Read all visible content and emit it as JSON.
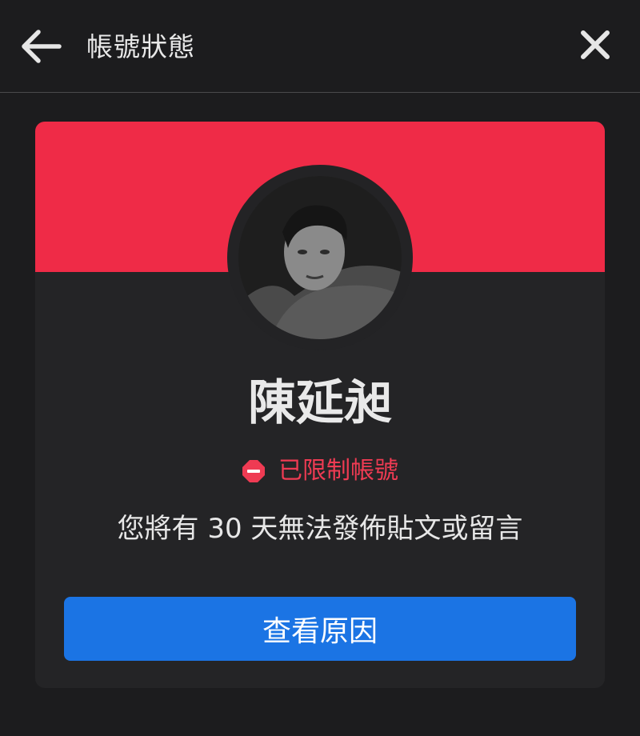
{
  "header": {
    "title": "帳號狀態",
    "back_icon": "arrow-left-icon",
    "close_icon": "close-icon"
  },
  "profile": {
    "name": "陳延昶",
    "status": "已限制帳號",
    "status_icon": "restricted-icon",
    "message": "您將有 30 天無法發佈貼文或留言",
    "button_label": "查看原因"
  },
  "colors": {
    "background": "#1c1c1e",
    "card": "#242426",
    "banner": "#ef2b47",
    "status_red": "#ef3b53",
    "button_blue": "#1b74e4"
  }
}
